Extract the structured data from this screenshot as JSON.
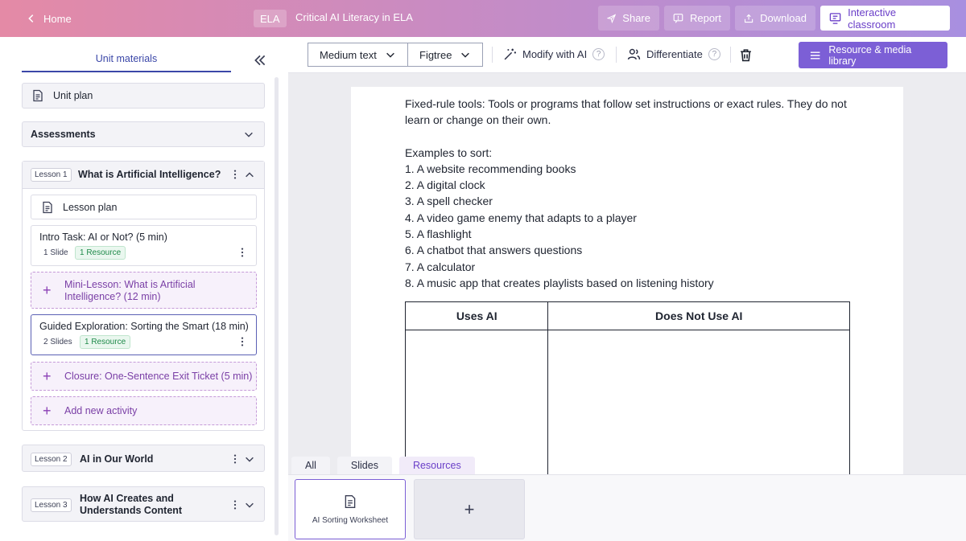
{
  "topbar": {
    "home_label": "Home",
    "subject": "ELA",
    "unit_title": "Critical AI Literacy in ELA",
    "buttons": {
      "share": "Share",
      "report": "Report",
      "download": "Download",
      "interactive": "Interactive classroom"
    }
  },
  "sidebar": {
    "tab_label": "Unit materials",
    "unit_plan": "Unit plan",
    "assessments": "Assessments",
    "lesson1": {
      "tag": "Lesson 1",
      "title": "What is Artificial Intelligence?",
      "lesson_plan": "Lesson plan",
      "activities": [
        {
          "title": "Intro Task: AI or Not? (5 min)",
          "slides": "1 Slide",
          "resources": "1 Resource"
        },
        {
          "title": "Mini-Lesson: What is Artificial Intelligence? (12 min)"
        },
        {
          "title": "Guided Exploration: Sorting the Smart (18 min)",
          "slides": "2 Slides",
          "resources": "1 Resource"
        },
        {
          "title": "Closure: One-Sentence Exit Ticket (5 min)"
        }
      ],
      "add_activity": "Add new activity"
    },
    "lesson2": {
      "tag": "Lesson 2",
      "title": "AI in Our World"
    },
    "lesson3": {
      "tag": "Lesson 3",
      "title": "How AI Creates and Understands Content"
    }
  },
  "toolbar": {
    "text_size": "Medium text",
    "font": "Figtree",
    "modify_ai": "Modify with AI",
    "differentiate": "Differentiate",
    "library": "Resource & media library",
    "help_glyph": "?"
  },
  "document": {
    "definition": "Fixed-rule tools: Tools or programs that follow set instructions or exact rules. They do not learn or change on their own.",
    "examples_heading": "Examples to sort:",
    "examples": [
      "1. A website recommending books",
      "2. A digital clock",
      "3. A spell checker",
      "4. A video game enemy that adapts to a player",
      "5. A flashlight",
      "6. A chatbot that answers questions",
      "7. A calculator",
      "8. A music app that creates playlists based on listening history"
    ],
    "table_headers": [
      "Uses AI",
      "Does Not Use AI"
    ]
  },
  "bottom": {
    "tabs": [
      "All",
      "Slides",
      "Resources"
    ],
    "active_tab": "Resources",
    "thumb_label": "AI Sorting Worksheet",
    "add_glyph": "+"
  },
  "colors": {
    "accent": "#7c5fd6",
    "link_purple": "#7a3fa6",
    "tab_blue": "#3b47a8",
    "resource_green": "#1f8a4a"
  },
  "icons": [
    "chevron-left-icon",
    "send-icon",
    "report-icon",
    "download-icon",
    "classroom-icon",
    "collapse-icon",
    "document-icon",
    "chevron-down-icon",
    "chevron-up-icon",
    "kebab-icon",
    "plus-icon",
    "magic-wand-icon",
    "users-icon",
    "trash-icon",
    "menu-icon"
  ]
}
